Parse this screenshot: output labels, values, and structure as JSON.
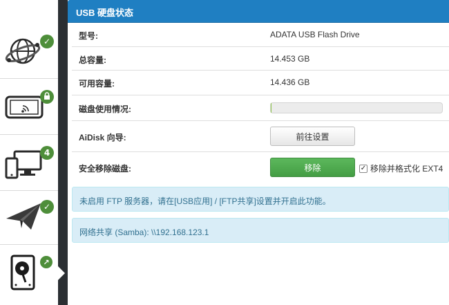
{
  "sidebar": {
    "items": [
      {
        "icon": "network-globe-icon",
        "badge": "✓",
        "badge_icon": "check-icon"
      },
      {
        "icon": "tablet-wifi-icon",
        "badge": "🔒",
        "badge_icon": "lock-icon"
      },
      {
        "icon": "devices-icon",
        "badge": "4",
        "badge_icon": "count"
      },
      {
        "icon": "paper-plane-icon",
        "badge": "✓",
        "badge_icon": "check-icon"
      },
      {
        "icon": "hard-disk-icon",
        "badge": "↗",
        "badge_icon": "external-link-icon"
      }
    ]
  },
  "panel": {
    "title": "USB 硬盘状态",
    "header_color": "#1f7fc2",
    "rows": {
      "model": {
        "label": "型号:",
        "value": "ADATA USB Flash Drive"
      },
      "total": {
        "label": "总容量:",
        "value": "14.453 GB"
      },
      "available": {
        "label": "可用容量:",
        "value": "14.436 GB"
      },
      "usage": {
        "label": "磁盘使用情况:",
        "percent": 0.1
      },
      "aidisk": {
        "label": "AiDisk 向导:",
        "button": "前往设置"
      },
      "remove": {
        "label": "安全移除磁盘:",
        "button": "移除",
        "checkbox_label": "移除并格式化 EXT4",
        "checkbox_checked": true
      }
    },
    "alerts": {
      "ftp": "未启用 FTP 服务器，请在[USB应用] / [FTP共享]设置并开启此功能。",
      "samba": "网络共享 (Samba): \\\\192.168.123.1"
    }
  }
}
